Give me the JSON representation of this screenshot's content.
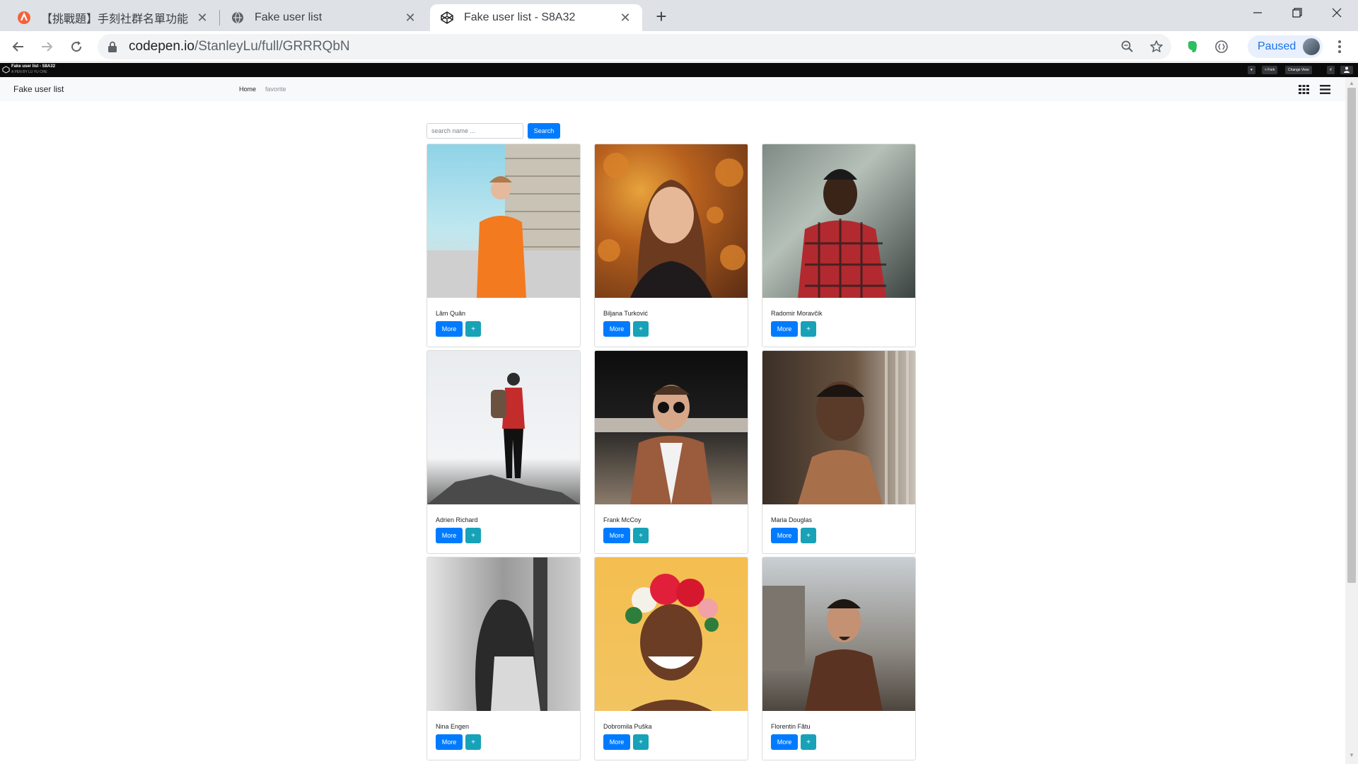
{
  "tabs": [
    {
      "title": "【挑戰題】手刻社群名單功能 | Al",
      "icon": "alpha-camp-icon"
    },
    {
      "title": "Fake user list",
      "icon": "globe-icon"
    },
    {
      "title": "Fake user list - S8A32",
      "icon": "codepen-icon"
    }
  ],
  "toolbar": {
    "url_host": "codepen.io",
    "url_path": "/StanleyLu/full/GRRRQbN",
    "profile_label": "Paused"
  },
  "codepen": {
    "title": "Fake user list - S8A32",
    "author": "A PEN BY LU YU CHE",
    "buttons": [
      "♥",
      "< Fork",
      "Change View",
      "#"
    ]
  },
  "app": {
    "brand": "Fake user list",
    "nav": {
      "home": "Home",
      "favorite": "favorite"
    },
    "search": {
      "placeholder": "search name ...",
      "button": "Search"
    },
    "card_buttons": {
      "more": "More",
      "add": "+"
    },
    "users": [
      {
        "name": "Lâm Quân",
        "photo": "woman-orange-shirt-photo"
      },
      {
        "name": "Biljana Turković",
        "photo": "woman-autumn-leaves-photo"
      },
      {
        "name": "Radomir Moravčik",
        "photo": "man-plaid-shirt-photo"
      },
      {
        "name": "Adrien Richard",
        "photo": "hiker-on-rock-photo"
      },
      {
        "name": "Frank McCoy",
        "photo": "man-sunglasses-photo"
      },
      {
        "name": "Maria Douglas",
        "photo": "woman-portrait-photo"
      },
      {
        "name": "Nina Engen",
        "photo": "woman-silhouette-bw-photo"
      },
      {
        "name": "Dobromila Puška",
        "photo": "woman-flower-crown-photo"
      },
      {
        "name": "Florentin Fătu",
        "photo": "man-brown-jacket-photo"
      }
    ]
  },
  "colors": {
    "primary": "#007bff",
    "info": "#17a2b8",
    "navbar": "#f8f9fa"
  }
}
